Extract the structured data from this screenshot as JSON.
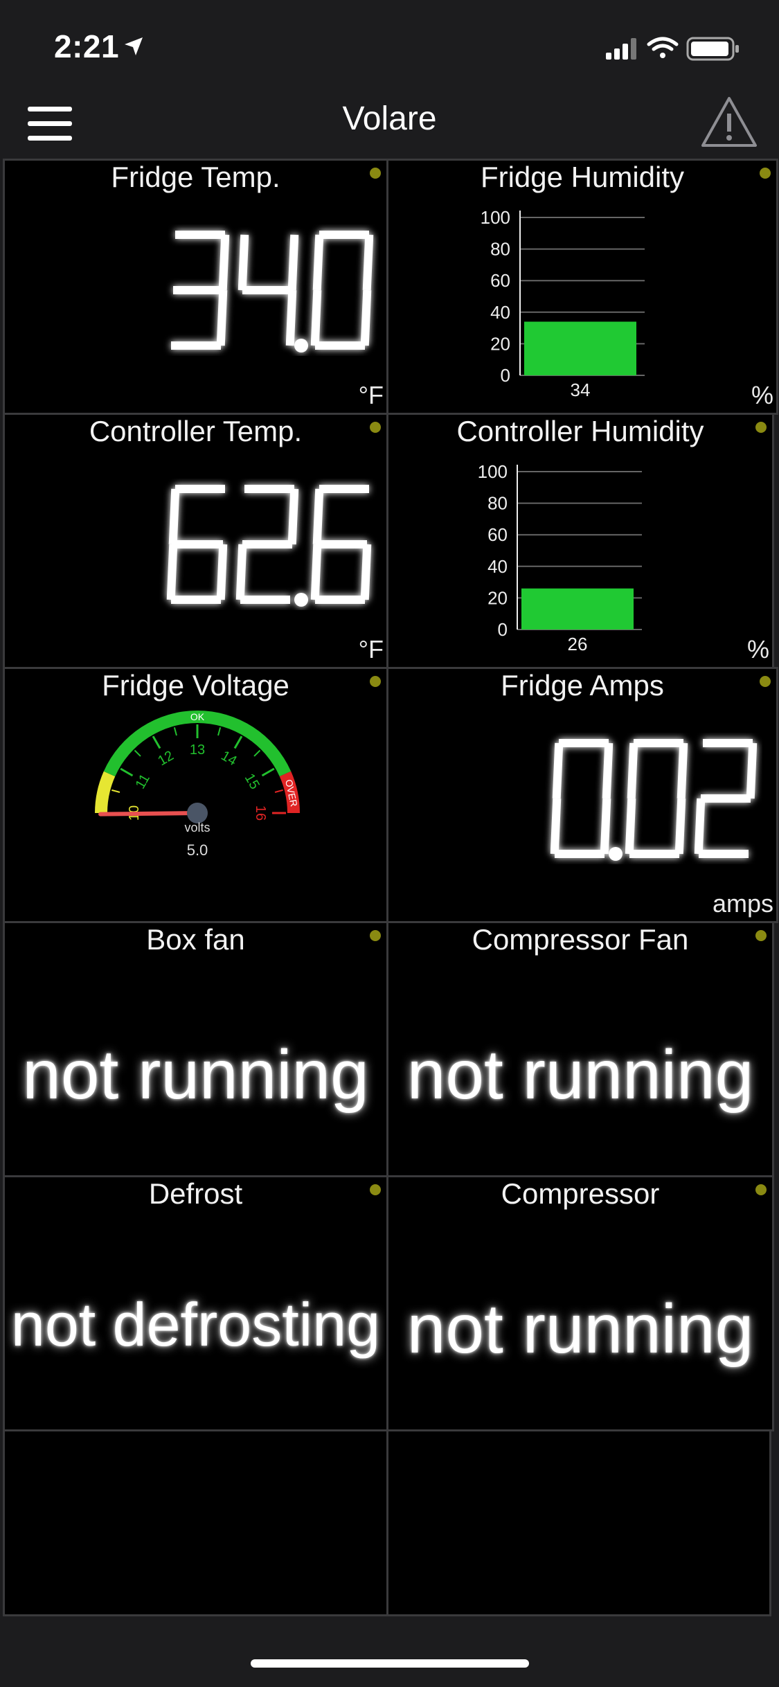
{
  "status": {
    "time": "2:21"
  },
  "header": {
    "title": "Volare"
  },
  "tiles": {
    "fridge_temp": {
      "title": "Fridge Temp.",
      "value": "34.0",
      "unit": "°F"
    },
    "fridge_humidity": {
      "title": "Fridge Humidity",
      "unit": "%"
    },
    "controller_temp": {
      "title": "Controller Temp.",
      "value": "62.6",
      "unit": "°F"
    },
    "controller_humidity": {
      "title": "Controller Humidity",
      "unit": "%"
    },
    "fridge_voltage": {
      "title": "Fridge Voltage"
    },
    "fridge_amps": {
      "title": "Fridge Amps",
      "value": "0.02",
      "unit": "amps"
    },
    "box_fan": {
      "title": "Box fan",
      "status": "not running"
    },
    "compressor_fan": {
      "title": "Compressor Fan",
      "status": "not running"
    },
    "defrost": {
      "title": "Defrost",
      "status": "not defrosting"
    },
    "compressor": {
      "title": "Compressor",
      "status": "not running"
    }
  },
  "chart_data": [
    {
      "type": "bar",
      "categories": [
        "34"
      ],
      "values": [
        34
      ],
      "ylim": [
        0,
        100
      ],
      "yticks": [
        0,
        20,
        40,
        60,
        80,
        100
      ],
      "bar_color": "#20c933"
    },
    {
      "type": "bar",
      "categories": [
        "26"
      ],
      "values": [
        26
      ],
      "ylim": [
        0,
        100
      ],
      "yticks": [
        0,
        20,
        40,
        60,
        80,
        100
      ],
      "bar_color": "#20c933"
    }
  ],
  "gauge": {
    "value": 5.0,
    "value_label": "5.0",
    "unit_label": "volts",
    "min": 10,
    "max": 16,
    "ticks": [
      "10",
      "11",
      "12",
      "13",
      "14",
      "15",
      "16"
    ],
    "ok_label": "OK",
    "over_label": "OVER",
    "zone_colors": {
      "low": "#e6e632",
      "ok": "#22c02e",
      "over": "#e02424"
    },
    "needle_color": "#e85050"
  },
  "colors": {
    "dot": "#8a8a12",
    "background": "#000000",
    "border": "#3a3a3c"
  }
}
